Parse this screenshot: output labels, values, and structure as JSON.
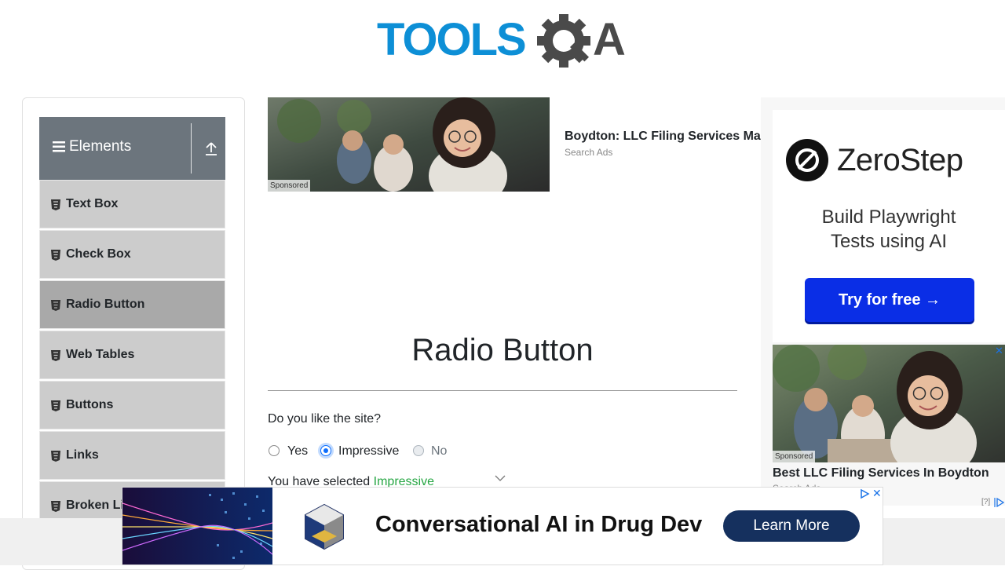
{
  "header": {
    "logo_text": "TOOLSQA"
  },
  "sidebar": {
    "group_title": "Elements",
    "items": [
      {
        "label": "Text Box"
      },
      {
        "label": "Check Box"
      },
      {
        "label": "Radio Button",
        "active": true
      },
      {
        "label": "Web Tables"
      },
      {
        "label": "Buttons"
      },
      {
        "label": "Links"
      },
      {
        "label": "Broken Links - Images"
      }
    ]
  },
  "top_ad": {
    "sponsored": "Sponsored",
    "title": "Boydton: LLC Filing Services Ma",
    "subtitle": "Search Ads"
  },
  "main": {
    "title": "Radio Button",
    "question": "Do you like the site?",
    "options": [
      {
        "label": "Yes",
        "checked": false,
        "disabled": false
      },
      {
        "label": "Impressive",
        "checked": true,
        "disabled": false
      },
      {
        "label": "No",
        "checked": false,
        "disabled": true
      }
    ],
    "result_prefix": "You have selected",
    "result_value": "Impressive"
  },
  "right_ad": {
    "brand": "ZeroStep",
    "tagline_line1": "Build Playwright",
    "tagline_line2": "Tests using AI",
    "button": "Try for free →",
    "sponsored": "Sponsored",
    "title": "Best LLC Filing Services In Boydton",
    "subtitle": "Search Ads",
    "help": "[?]"
  },
  "bottom_ad": {
    "headline": "Conversational AI in Drug Dev",
    "cta": "Learn More"
  },
  "colors": {
    "sidebar_header": "#6c757d",
    "menu_item": "#cccccc",
    "menu_item_active": "#a9a9a9",
    "radio_checked": "#0d6efd",
    "result_value": "#28a745",
    "zerostep_button": "#0a2ee6",
    "bottom_cta": "#15305e",
    "logo_blue": "#0d8fd6"
  }
}
